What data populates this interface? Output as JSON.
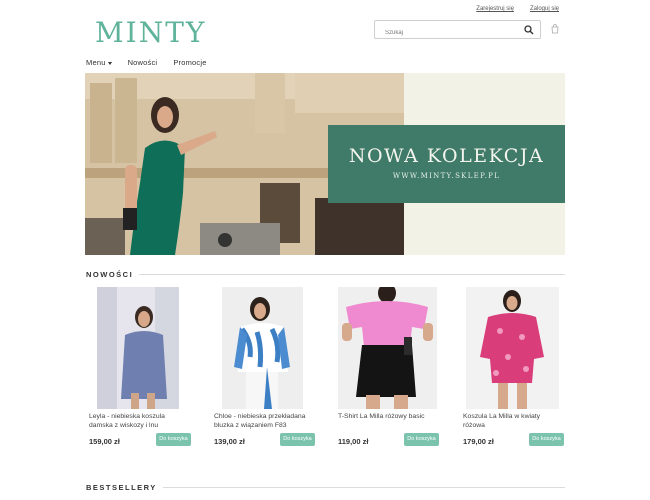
{
  "header": {
    "register": "Zarejestruj się",
    "login": "Zaloguj się",
    "logo": "MINTY",
    "search_placeholder": "Szukaj"
  },
  "nav": {
    "menu": "Menu",
    "new": "Nowości",
    "promo": "Promocje"
  },
  "hero": {
    "title": "NOWA KOLEKCJA",
    "subtitle": "WWW.MINTY.SKLEP.PL"
  },
  "sections": {
    "new": "NOWOŚCI",
    "bestsellers": "BESTSELLERY"
  },
  "products": [
    {
      "name": "Leyla - niebieska koszula damska z wiskozy i lnu",
      "price": "159,00 zł",
      "button": "Do koszyka"
    },
    {
      "name": "Chloe - niebieska przekładana bluzka z wiązaniem F83",
      "price": "139,00 zł",
      "button": "Do koszyka"
    },
    {
      "name": "T-Shirt La Milla różowy basic",
      "price": "119,00 zł",
      "button": "Do koszyka"
    },
    {
      "name": "Koszula La Milla w kwiaty różowa",
      "price": "179,00 zł",
      "button": "Do koszyka"
    }
  ],
  "colors": {
    "brand": "#5fb39a",
    "hero_panel": "#3f7b68",
    "button": "#7cc3ae"
  }
}
